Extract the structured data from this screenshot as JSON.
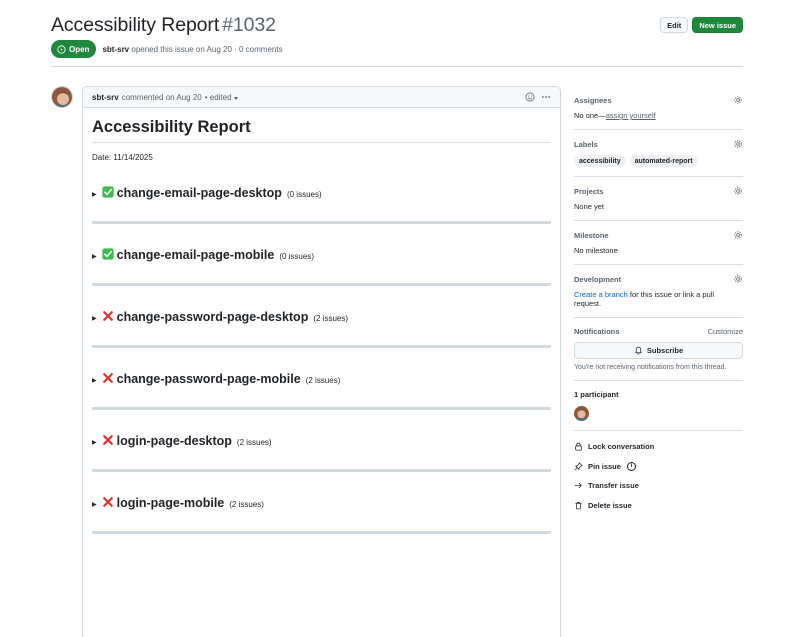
{
  "issue": {
    "title": "Accessibility Report",
    "number": "#1032",
    "state": "Open",
    "author": "sbt-srv",
    "opened_text": "opened this issue on Aug 20 · 0 comments"
  },
  "header_actions": {
    "edit_label": "Edit",
    "new_issue_label": "New issue"
  },
  "comment": {
    "author": "sbt-srv",
    "meta": "commented on Aug 20",
    "edited": "• edited",
    "heading": "Accessibility Report",
    "date": "Date: 11/14/2025",
    "sections": [
      {
        "status": "pass",
        "name": "change-email-page-desktop",
        "count": "(0 issues)"
      },
      {
        "status": "pass",
        "name": "change-email-page-mobile",
        "count": "(0 issues)"
      },
      {
        "status": "fail",
        "name": "change-password-page-desktop",
        "count": "(2 issues)"
      },
      {
        "status": "fail",
        "name": "change-password-page-mobile",
        "count": "(2 issues)"
      },
      {
        "status": "fail",
        "name": "login-page-desktop",
        "count": "(2 issues)"
      },
      {
        "status": "fail",
        "name": "login-page-mobile",
        "count": "(2 issues)"
      }
    ]
  },
  "sidebar": {
    "assignees": {
      "title": "Assignees",
      "none": "No one—",
      "link": "assign yourself"
    },
    "labels": {
      "title": "Labels",
      "items": [
        "accessibility",
        "automated-report"
      ]
    },
    "projects": {
      "title": "Projects",
      "value": "None yet"
    },
    "milestone": {
      "title": "Milestone",
      "value": "No milestone"
    },
    "development": {
      "title": "Development",
      "link": "Create a branch",
      "rest": " for this issue or link a pull request."
    },
    "notifications": {
      "title": "Notifications",
      "customize": "Customize",
      "subscribe": "Subscribe",
      "note": "You're not receiving notifications from this thread."
    },
    "participants": {
      "title": "1 participant"
    },
    "actions": {
      "lock": "Lock conversation",
      "pin": "Pin issue",
      "transfer": "Transfer issue",
      "delete": "Delete issue"
    }
  },
  "colors": {
    "open_green": "#1f883d",
    "link_blue": "#0969da",
    "muted": "#59636e",
    "border": "#d1d9e0"
  },
  "icons": [
    "open-issue-icon",
    "smiley-icon",
    "kebab-icon",
    "gear-icon",
    "bell-icon",
    "lock-icon",
    "pin-icon",
    "info-icon",
    "arrow-right-icon",
    "trash-icon",
    "check-mark-icon",
    "cross-mark-icon",
    "triangle-right-icon"
  ]
}
